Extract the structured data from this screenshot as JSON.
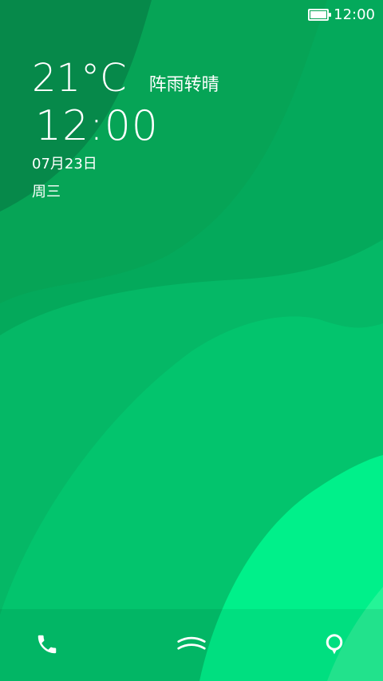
{
  "status_bar": {
    "time": "12:00",
    "battery_level": 0.9
  },
  "weather": {
    "temperature": "21°C",
    "condition": "阵雨转晴"
  },
  "clock": {
    "time": "12:00"
  },
  "date": {
    "date": "07月23日",
    "weekday": "周三"
  },
  "bottom_bar": {
    "left_icon": "phone-icon",
    "center_icon": "unlock-chevron-icon",
    "right_icon": "location-pin-icon"
  },
  "colors": {
    "wallpaper_dark": "#06894a",
    "wallpaper_mid": "#05b866",
    "wallpaper_light": "#00f08a",
    "text": "#ffffff"
  }
}
